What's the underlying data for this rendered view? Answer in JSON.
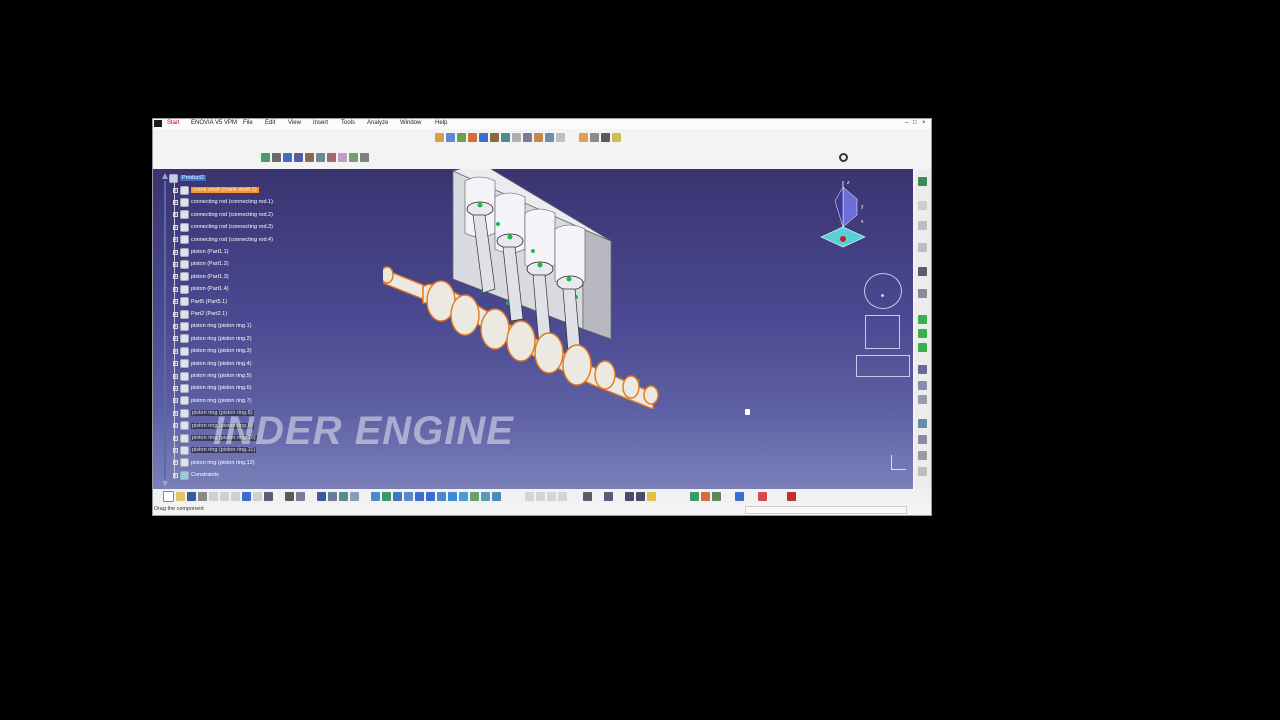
{
  "menu": [
    "Start",
    "ENOVIA V5 VPM",
    "File",
    "Edit",
    "View",
    "Insert",
    "Tools",
    "Analyze",
    "Window",
    "Help"
  ],
  "tree": {
    "root": "Product2",
    "items": [
      "crank shaft (crank shaft.1)",
      "connecting rod (connecting rod.1)",
      "connecting rod (connecting rod.2)",
      "connecting rod (connecting rod.3)",
      "connecting rod (connecting rod.4)",
      "piston (Part1.1)",
      "piston (Part1.2)",
      "piston (Part1.3)",
      "piston (Part1.4)",
      "Part5 (Part5.1)",
      "Part2 (Part2.1)",
      "piston ring (piston ring.1)",
      "piston ring (piston ring.2)",
      "piston ring (piston ring.3)",
      "piston ring (piston ring.4)",
      "piston ring (piston ring.5)",
      "piston ring (piston ring.6)",
      "piston ring (piston ring.7)",
      "piston ring (piston ring.8)",
      "piston ring (piston ring.9)",
      "piston ring (piston ring.10)",
      "piston ring (piston ring.11)",
      "piston ring (piston ring.12)",
      "Constraints"
    ]
  },
  "watermark": "INDER ENGINE",
  "compass": {
    "x_label": "x",
    "y_label": "y",
    "z_label": "z"
  },
  "status": {
    "message": "Drag the component"
  },
  "colors": {
    "selection": "#f3942f",
    "viewport_top": "#3a3470",
    "viewport_bottom": "#7b80b8"
  }
}
